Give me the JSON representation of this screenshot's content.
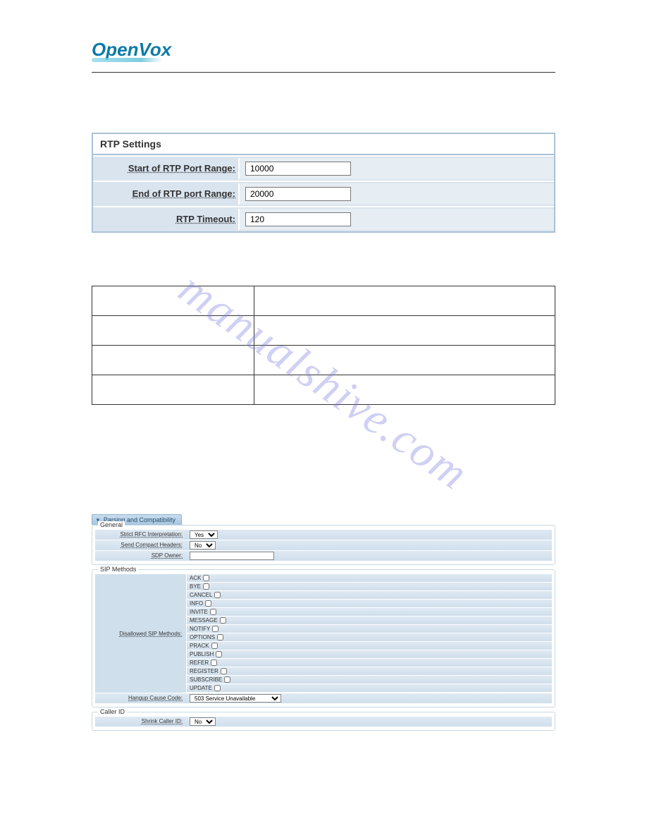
{
  "logo": {
    "text": "OpenVox"
  },
  "watermark": "manualshive.com",
  "rtp": {
    "title": "RTP Settings",
    "rows": [
      {
        "label": "Start of RTP Port Range:",
        "value": "10000"
      },
      {
        "label": "End of RTP port Range:",
        "value": "20000"
      },
      {
        "label": "RTP Timeout:",
        "value": "120"
      }
    ]
  },
  "parsing": {
    "tab": "Parsing and Compatibility",
    "general": {
      "legend": "General",
      "strict_label": "Strict RFC Interpretation:",
      "strict_value": "Yes",
      "compact_label": "Send Compact Headers:",
      "compact_value": "No",
      "sdp_label": "SDP Owner:",
      "sdp_value": ""
    },
    "sip_methods": {
      "legend": "SIP Methods",
      "disallowed_label": "Disallowed SIP Methods:",
      "methods": [
        "ACK",
        "BYE",
        "CANCEL",
        "INFO",
        "INVITE",
        "MESSAGE",
        "NOTIFY",
        "OPTIONS",
        "PRACK",
        "PUBLISH",
        "REFER",
        "REGISTER",
        "SUBSCRIBE",
        "UPDATE"
      ],
      "hangup_label": "Hangup Cause Code:",
      "hangup_value": "503 Service Unavailable"
    },
    "caller_id": {
      "legend": "Caller ID",
      "shrink_label": "Shrink Caller ID:",
      "shrink_value": "No"
    }
  }
}
